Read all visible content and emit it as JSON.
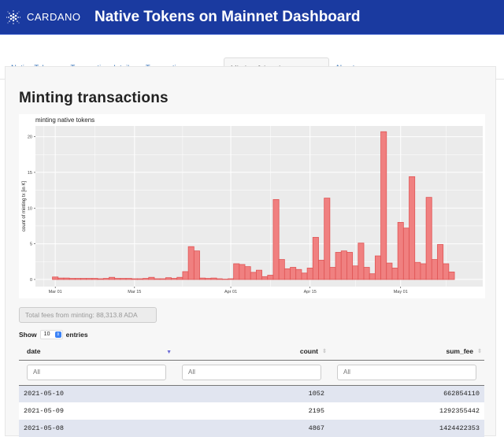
{
  "header": {
    "logo_text": "CARDANO",
    "title": "Native Tokens on Mainnet Dashboard",
    "logo_icon": "cardano-logo-icon",
    "bg_color": "#1a3aa0"
  },
  "tabs": [
    {
      "label": "Native Tokens",
      "active": false
    },
    {
      "label": "Transaction details",
      "active": false
    },
    {
      "label": "Transaction summary",
      "active": false
    },
    {
      "label": "Minting & burning summary",
      "active": true
    },
    {
      "label": "About",
      "active": false
    }
  ],
  "main": {
    "section_title": "Minting transactions",
    "fees_text": "Total fees from minting: 88,313.8 ADA",
    "length": {
      "show_label": "Show",
      "value": "10",
      "entries_label": "entries"
    },
    "table": {
      "columns": [
        {
          "label": "date",
          "sort": "desc"
        },
        {
          "label": "count",
          "sort": "none"
        },
        {
          "label": "sum_fee",
          "sort": "none"
        }
      ],
      "filters": [
        {
          "placeholder": "All"
        },
        {
          "placeholder": "All"
        },
        {
          "placeholder": "All"
        }
      ],
      "rows": [
        [
          "2021-05-10",
          "1052",
          "662854110"
        ],
        [
          "2021-05-09",
          "2195",
          "1292355442"
        ],
        [
          "2021-05-08",
          "4867",
          "1424422353"
        ]
      ]
    }
  },
  "chart_data": {
    "type": "bar",
    "title": "minting native tokens",
    "xlabel": "",
    "ylabel": "count of minting tx [in K]",
    "ylim": [
      -1,
      21.5
    ],
    "yticks": [
      0,
      5,
      10,
      15,
      20
    ],
    "xticks": [
      {
        "label": "Mar 01",
        "day": 0
      },
      {
        "label": "Mar 15",
        "day": 14
      },
      {
        "label": "Apr 01",
        "day": 31
      },
      {
        "label": "Apr 15",
        "day": 45
      },
      {
        "label": "May 01",
        "day": 61
      }
    ],
    "xlim_days": [
      -3.5,
      75.5
    ],
    "start_date": "2021-03-01",
    "bar_color": "#f08080",
    "bar_outline": "#e05555",
    "grid": true,
    "values": [
      0.35,
      0.2,
      0.2,
      0.15,
      0.15,
      0.15,
      0.15,
      0.15,
      0.1,
      0.15,
      0.3,
      0.15,
      0.15,
      0.15,
      0.1,
      0.1,
      0.15,
      0.3,
      0.1,
      0.1,
      0.25,
      0.15,
      0.3,
      1.1,
      4.6,
      4.0,
      0.2,
      0.15,
      0.2,
      0.1,
      0.05,
      0.1,
      2.2,
      2.1,
      1.8,
      1.0,
      1.3,
      0.4,
      0.6,
      11.2,
      2.8,
      1.5,
      1.7,
      1.4,
      0.9,
      1.6,
      5.9,
      2.7,
      11.4,
      1.7,
      3.8,
      4.0,
      3.8,
      1.9,
      5.1,
      1.7,
      0.8,
      3.3,
      20.7,
      2.3,
      1.6,
      8.0,
      7.2,
      14.4,
      2.4,
      2.2,
      11.5,
      2.8,
      4.9,
      2.2,
      1.05
    ]
  }
}
